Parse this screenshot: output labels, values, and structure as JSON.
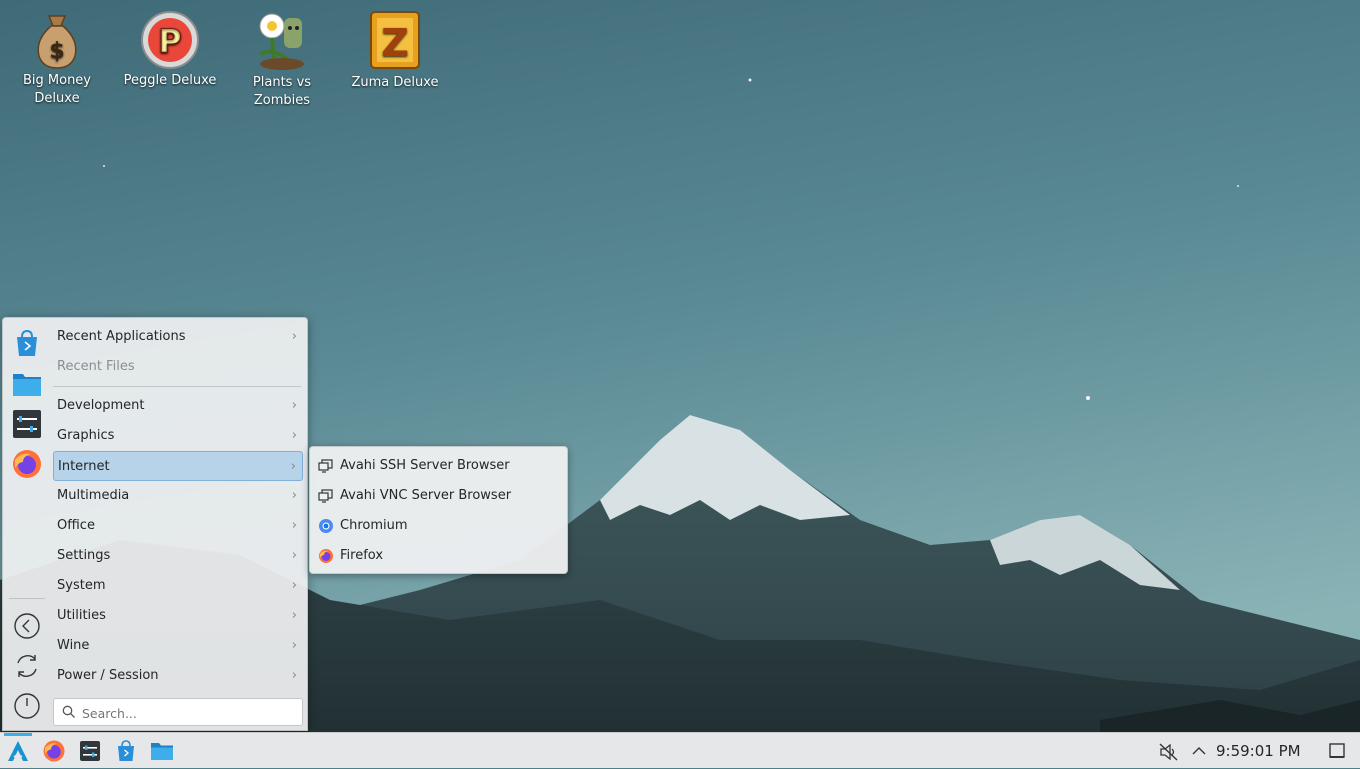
{
  "desktop": {
    "icons": [
      {
        "label": "Big Money\nDeluxe",
        "icon": "money-bag-icon"
      },
      {
        "label": "Peggle Deluxe",
        "icon": "peggle-icon"
      },
      {
        "label": "Plants vs\nZombies",
        "icon": "plants-vs-zombies-icon"
      },
      {
        "label": "Zuma Deluxe",
        "icon": "zuma-icon"
      }
    ]
  },
  "menu": {
    "favorites": [
      {
        "icon": "discover-store-icon"
      },
      {
        "icon": "file-manager-icon"
      },
      {
        "icon": "system-settings-icon"
      },
      {
        "icon": "firefox-icon"
      }
    ],
    "side_buttons": [
      {
        "icon": "back-arrow-icon"
      },
      {
        "icon": "restart-icon"
      },
      {
        "icon": "power-icon"
      }
    ],
    "top_items": [
      {
        "label": "Recent Applications",
        "has_submenu": true
      },
      {
        "label": "Recent Files",
        "has_submenu": false,
        "disabled": true
      }
    ],
    "categories": [
      {
        "label": "Development"
      },
      {
        "label": "Graphics"
      },
      {
        "label": "Internet",
        "selected": true
      },
      {
        "label": "Multimedia"
      },
      {
        "label": "Office"
      },
      {
        "label": "Settings"
      },
      {
        "label": "System"
      },
      {
        "label": "Utilities"
      },
      {
        "label": "Wine"
      },
      {
        "label": "Power / Session"
      }
    ],
    "chevron": "›",
    "search_placeholder": "Search..."
  },
  "submenu": {
    "items": [
      {
        "label": "Avahi SSH Server Browser",
        "icon": "network-monitor-icon"
      },
      {
        "label": "Avahi VNC Server Browser",
        "icon": "network-monitor-icon"
      },
      {
        "label": "Chromium",
        "icon": "chromium-icon"
      },
      {
        "label": "Firefox",
        "icon": "firefox-icon"
      }
    ]
  },
  "taskbar": {
    "launchers": [
      {
        "icon": "app-launcher-icon"
      },
      {
        "icon": "firefox-icon"
      },
      {
        "icon": "system-settings-icon"
      },
      {
        "icon": "discover-store-icon"
      },
      {
        "icon": "file-manager-icon"
      }
    ],
    "tray": [
      {
        "icon": "volume-muted-icon"
      },
      {
        "icon": "tray-expand-icon"
      }
    ],
    "clock": "9:59:01 PM",
    "show_desktop_icon": "show-desktop-icon"
  },
  "colors": {
    "accent": "#3daee9",
    "selection": "#b6d3ea",
    "panel": "#e6e7e8"
  }
}
